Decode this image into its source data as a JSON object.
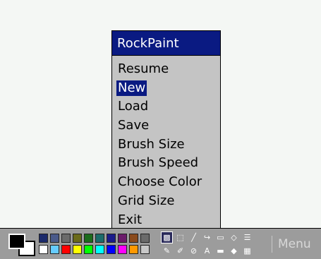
{
  "menu": {
    "title": "RockPaint",
    "items": [
      {
        "label": "Resume",
        "selected": false
      },
      {
        "label": "New",
        "selected": true
      },
      {
        "label": "Load",
        "selected": false
      },
      {
        "label": "Save",
        "selected": false
      },
      {
        "label": "Brush Size",
        "selected": false
      },
      {
        "label": "Brush Speed",
        "selected": false
      },
      {
        "label": "Choose Color",
        "selected": false
      },
      {
        "label": "Grid Size",
        "selected": false
      },
      {
        "label": "Exit",
        "selected": false
      }
    ]
  },
  "toolbar": {
    "foreground_color": "#000000",
    "background_color": "#ffffff",
    "palette_top": [
      "#1b2a6b",
      "#4a5a8a",
      "#6b6b6b",
      "#6b6b1b",
      "#1b6b1b",
      "#1b6b6b",
      "#1b1b8a",
      "#6b1b6b",
      "#8a4a1b",
      "#6b6b6b"
    ],
    "palette_bottom": [
      "#ffffff",
      "#66ccff",
      "#ff0000",
      "#ffff00",
      "#00ff00",
      "#00ffff",
      "#0000ff",
      "#ff00ff",
      "#ff9900",
      "#c8c8c8"
    ],
    "tools": [
      {
        "icon": "fill-pattern-icon",
        "glyph": "▩",
        "active": true
      },
      {
        "icon": "select-rect-icon",
        "glyph": "⬚",
        "active": false
      },
      {
        "icon": "line-icon",
        "glyph": "╱",
        "active": false
      },
      {
        "icon": "curve-icon",
        "glyph": "↪",
        "active": false
      },
      {
        "icon": "rectangle-icon",
        "glyph": "▭",
        "active": false
      },
      {
        "icon": "diamond-icon",
        "glyph": "◇",
        "active": false
      },
      {
        "icon": "gradient-icon",
        "glyph": "☰",
        "active": false
      },
      {
        "icon": "brush-icon",
        "glyph": "✎",
        "active": false
      },
      {
        "icon": "color-picker-icon",
        "glyph": "✐",
        "active": false
      },
      {
        "icon": "eraser-icon",
        "glyph": "⊘",
        "active": false
      },
      {
        "icon": "text-icon",
        "glyph": "A",
        "active": false
      },
      {
        "icon": "filled-rectangle-icon",
        "glyph": "▬",
        "active": false
      },
      {
        "icon": "filled-diamond-icon",
        "glyph": "◆",
        "active": false
      },
      {
        "icon": "filled-gradient-icon",
        "glyph": "▦",
        "active": false
      }
    ],
    "menu_label": "Menu"
  }
}
